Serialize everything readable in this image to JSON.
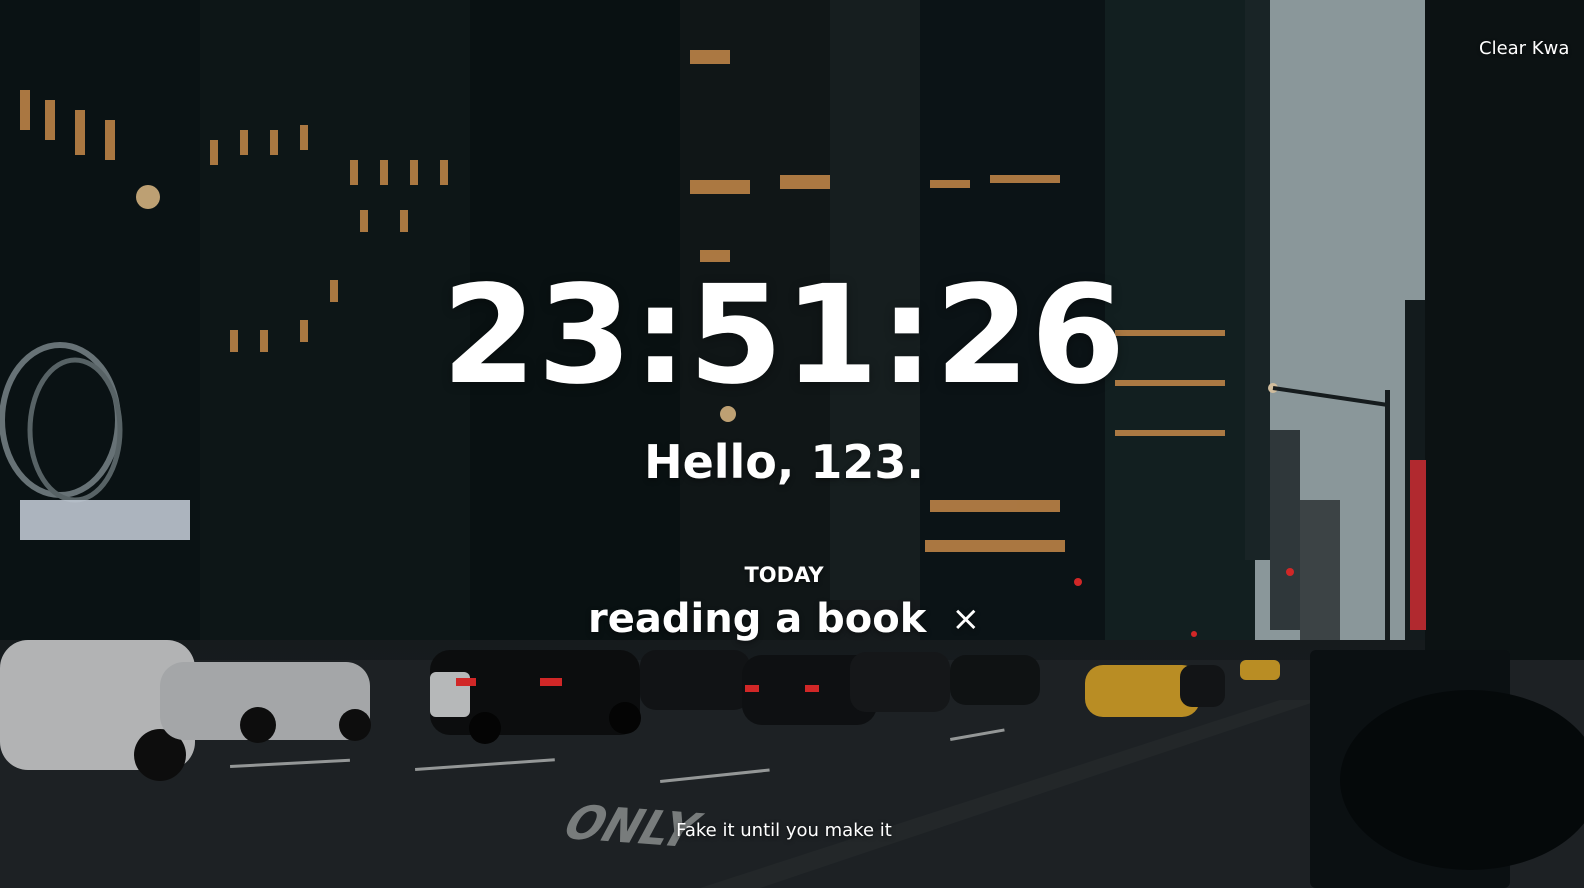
{
  "background": {
    "scene_icon": "city-street-night-photo",
    "sky_color": "#a9b9bc",
    "building_color": "#0d1719",
    "window_light_color": "#f2a85a",
    "road_color": "#24292c",
    "sign_color": "#d8323a"
  },
  "weather": {
    "text": "Clear Kwa"
  },
  "clock": {
    "time": "23:51:26"
  },
  "greeting": {
    "text": "Hello, 123."
  },
  "focus": {
    "label": "TODAY",
    "task": "reading a book",
    "close_icon": "×"
  },
  "quote": {
    "text": "Fake it until you make it"
  }
}
